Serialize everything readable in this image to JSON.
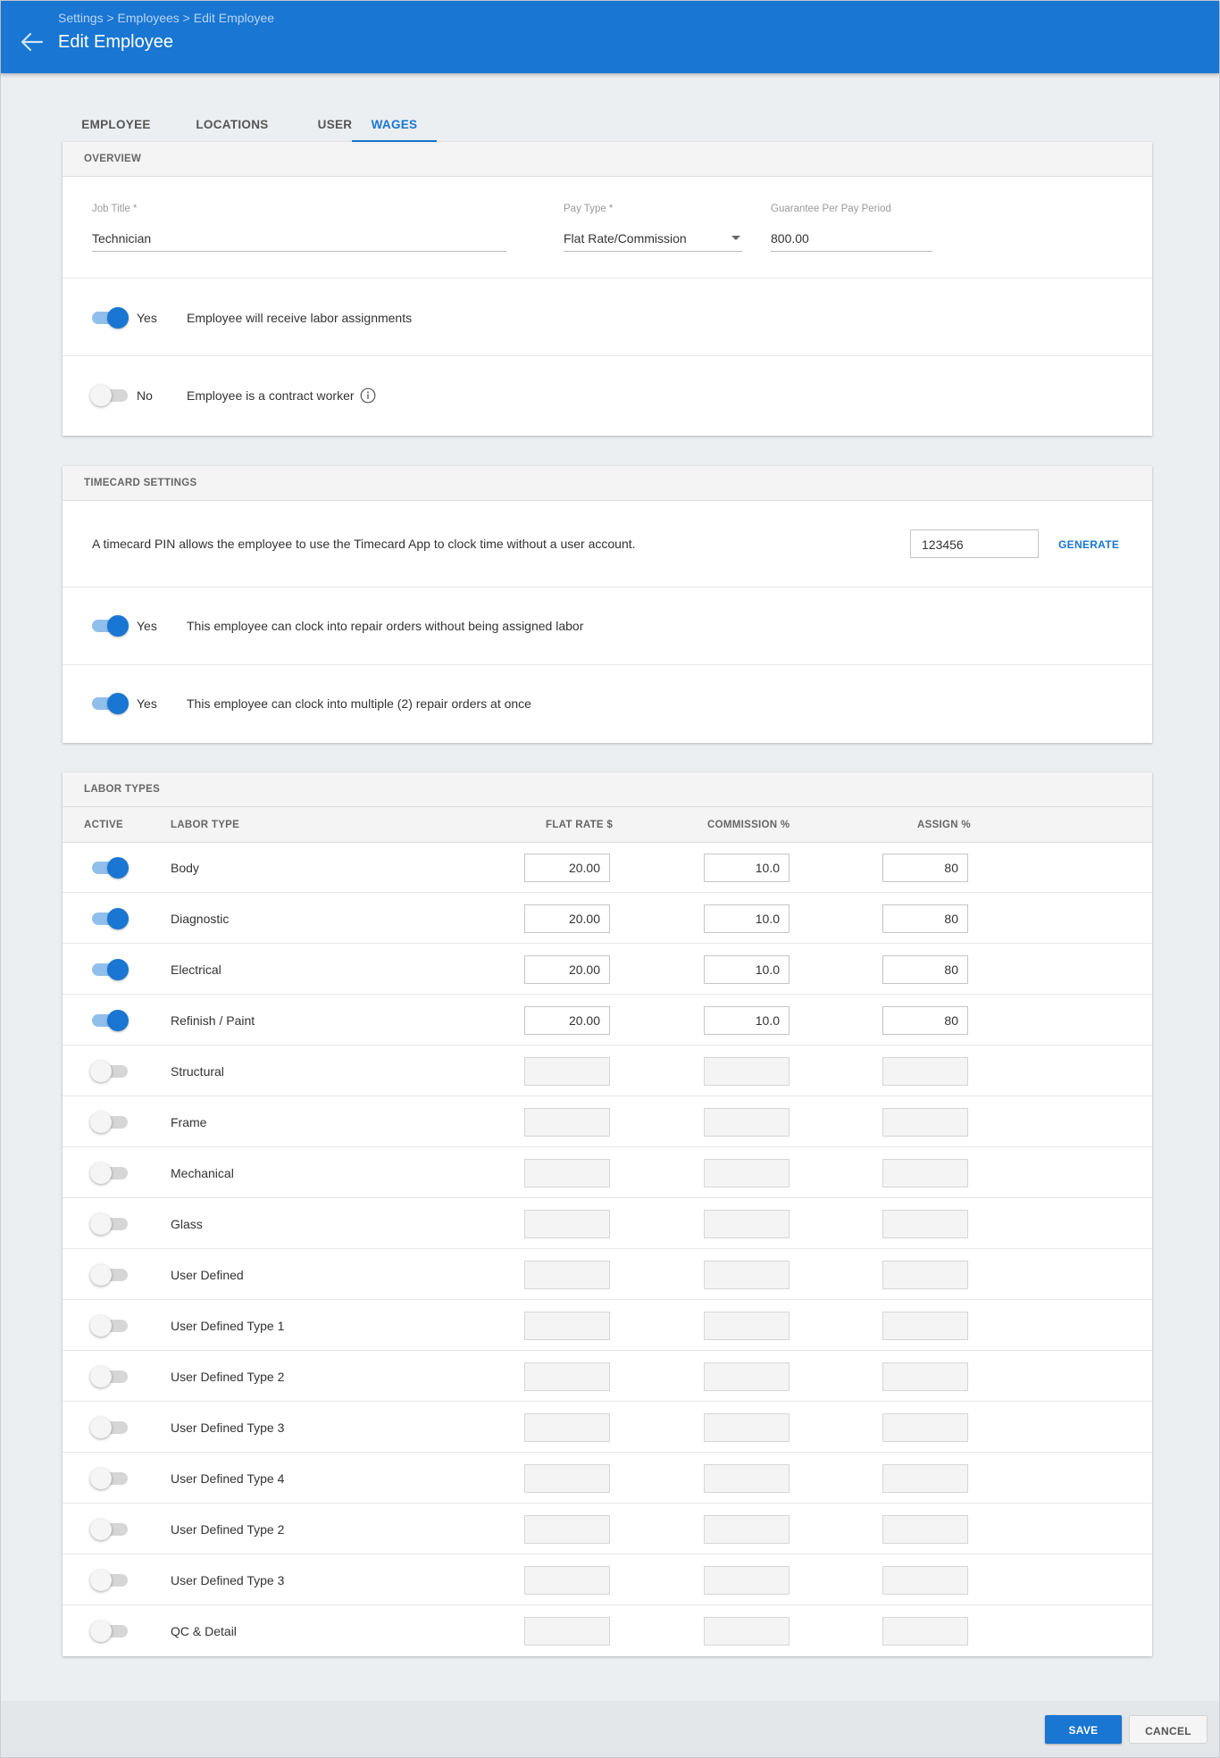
{
  "header": {
    "breadcrumb": "Settings > Employees > Edit Employee",
    "title": "Edit Employee",
    "back_icon": "arrow-left-icon"
  },
  "tabs": [
    {
      "label": "EMPLOYEE",
      "active": false
    },
    {
      "label": "LOCATIONS",
      "active": false
    },
    {
      "label": "USER",
      "active": false
    },
    {
      "label": "WAGES",
      "active": true
    }
  ],
  "overview": {
    "title": "OVERVIEW",
    "job_title": {
      "label": "Job Title *",
      "value": "Technician"
    },
    "pay_type": {
      "label": "Pay Type *",
      "value": "Flat Rate/Commission"
    },
    "guarantee": {
      "label": "Guarantee Per Pay Period",
      "value": "800.00"
    },
    "labor_assignments": {
      "on": true,
      "state": "Yes",
      "text": "Employee will receive labor assignments"
    },
    "contract_worker": {
      "on": false,
      "state": "No",
      "text": "Employee is a contract worker",
      "icon": "info-icon"
    }
  },
  "timecard": {
    "title": "TIMECARD SETTINGS",
    "pin_description": "A timecard PIN allows the employee to use the Timecard App to clock time without a user account.",
    "pin_value": "123456",
    "generate_label": "GENERATE",
    "clock_without_labor": {
      "on": true,
      "state": "Yes",
      "text": "This employee can clock into repair orders without being assigned labor"
    },
    "clock_multiple": {
      "on": true,
      "state": "Yes",
      "text": "This employee can clock into multiple (2) repair orders at once"
    }
  },
  "labor_types": {
    "title": "LABOR TYPES",
    "columns": {
      "active": "ACTIVE",
      "labor_type": "LABOR TYPE",
      "flat_rate": "FLAT RATE $",
      "commission": "COMMISSION %",
      "assign": "ASSIGN %"
    },
    "rows": [
      {
        "name": "Body",
        "active": true,
        "flat_rate": "20.00",
        "commission": "10.0",
        "assign": "80"
      },
      {
        "name": "Diagnostic",
        "active": true,
        "flat_rate": "20.00",
        "commission": "10.0",
        "assign": "80"
      },
      {
        "name": "Electrical",
        "active": true,
        "flat_rate": "20.00",
        "commission": "10.0",
        "assign": "80"
      },
      {
        "name": "Refinish / Paint",
        "active": true,
        "flat_rate": "20.00",
        "commission": "10.0",
        "assign": "80"
      },
      {
        "name": "Structural",
        "active": false,
        "flat_rate": "",
        "commission": "",
        "assign": ""
      },
      {
        "name": "Frame",
        "active": false,
        "flat_rate": "",
        "commission": "",
        "assign": ""
      },
      {
        "name": "Mechanical",
        "active": false,
        "flat_rate": "",
        "commission": "",
        "assign": ""
      },
      {
        "name": "Glass",
        "active": false,
        "flat_rate": "",
        "commission": "",
        "assign": ""
      },
      {
        "name": "User Defined",
        "active": false,
        "flat_rate": "",
        "commission": "",
        "assign": ""
      },
      {
        "name": "User Defined Type 1",
        "active": false,
        "flat_rate": "",
        "commission": "",
        "assign": ""
      },
      {
        "name": "User Defined Type 2",
        "active": false,
        "flat_rate": "",
        "commission": "",
        "assign": ""
      },
      {
        "name": "User Defined Type 3",
        "active": false,
        "flat_rate": "",
        "commission": "",
        "assign": ""
      },
      {
        "name": "User Defined Type 4",
        "active": false,
        "flat_rate": "",
        "commission": "",
        "assign": ""
      },
      {
        "name": "User Defined Type 2",
        "active": false,
        "flat_rate": "",
        "commission": "",
        "assign": ""
      },
      {
        "name": "User Defined Type 3",
        "active": false,
        "flat_rate": "",
        "commission": "",
        "assign": ""
      },
      {
        "name": "QC & Detail",
        "active": false,
        "flat_rate": "",
        "commission": "",
        "assign": ""
      }
    ]
  },
  "footer": {
    "save_label": "SAVE",
    "cancel_label": "CANCEL"
  },
  "colors": {
    "primary": "#1976d2",
    "toggle_track_on": "#90bfec",
    "toggle_track_off": "#d6d6d6",
    "page_background": "#eceff2"
  }
}
